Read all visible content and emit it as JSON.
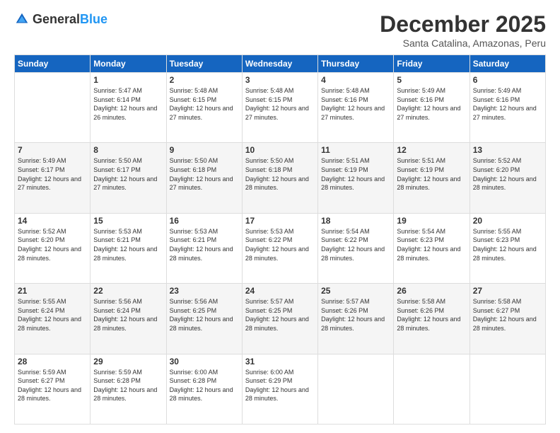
{
  "header": {
    "logo_general": "General",
    "logo_blue": "Blue",
    "month": "December 2025",
    "location": "Santa Catalina, Amazonas, Peru"
  },
  "days_of_week": [
    "Sunday",
    "Monday",
    "Tuesday",
    "Wednesday",
    "Thursday",
    "Friday",
    "Saturday"
  ],
  "weeks": [
    [
      {
        "day": "",
        "sunrise": "",
        "sunset": "",
        "daylight": "",
        "empty": true
      },
      {
        "day": "1",
        "sunrise": "Sunrise: 5:47 AM",
        "sunset": "Sunset: 6:14 PM",
        "daylight": "Daylight: 12 hours and 26 minutes."
      },
      {
        "day": "2",
        "sunrise": "Sunrise: 5:48 AM",
        "sunset": "Sunset: 6:15 PM",
        "daylight": "Daylight: 12 hours and 27 minutes."
      },
      {
        "day": "3",
        "sunrise": "Sunrise: 5:48 AM",
        "sunset": "Sunset: 6:15 PM",
        "daylight": "Daylight: 12 hours and 27 minutes."
      },
      {
        "day": "4",
        "sunrise": "Sunrise: 5:48 AM",
        "sunset": "Sunset: 6:16 PM",
        "daylight": "Daylight: 12 hours and 27 minutes."
      },
      {
        "day": "5",
        "sunrise": "Sunrise: 5:49 AM",
        "sunset": "Sunset: 6:16 PM",
        "daylight": "Daylight: 12 hours and 27 minutes."
      },
      {
        "day": "6",
        "sunrise": "Sunrise: 5:49 AM",
        "sunset": "Sunset: 6:16 PM",
        "daylight": "Daylight: 12 hours and 27 minutes."
      }
    ],
    [
      {
        "day": "7",
        "sunrise": "Sunrise: 5:49 AM",
        "sunset": "Sunset: 6:17 PM",
        "daylight": "Daylight: 12 hours and 27 minutes."
      },
      {
        "day": "8",
        "sunrise": "Sunrise: 5:50 AM",
        "sunset": "Sunset: 6:17 PM",
        "daylight": "Daylight: 12 hours and 27 minutes."
      },
      {
        "day": "9",
        "sunrise": "Sunrise: 5:50 AM",
        "sunset": "Sunset: 6:18 PM",
        "daylight": "Daylight: 12 hours and 27 minutes."
      },
      {
        "day": "10",
        "sunrise": "Sunrise: 5:50 AM",
        "sunset": "Sunset: 6:18 PM",
        "daylight": "Daylight: 12 hours and 28 minutes."
      },
      {
        "day": "11",
        "sunrise": "Sunrise: 5:51 AM",
        "sunset": "Sunset: 6:19 PM",
        "daylight": "Daylight: 12 hours and 28 minutes."
      },
      {
        "day": "12",
        "sunrise": "Sunrise: 5:51 AM",
        "sunset": "Sunset: 6:19 PM",
        "daylight": "Daylight: 12 hours and 28 minutes."
      },
      {
        "day": "13",
        "sunrise": "Sunrise: 5:52 AM",
        "sunset": "Sunset: 6:20 PM",
        "daylight": "Daylight: 12 hours and 28 minutes."
      }
    ],
    [
      {
        "day": "14",
        "sunrise": "Sunrise: 5:52 AM",
        "sunset": "Sunset: 6:20 PM",
        "daylight": "Daylight: 12 hours and 28 minutes."
      },
      {
        "day": "15",
        "sunrise": "Sunrise: 5:53 AM",
        "sunset": "Sunset: 6:21 PM",
        "daylight": "Daylight: 12 hours and 28 minutes."
      },
      {
        "day": "16",
        "sunrise": "Sunrise: 5:53 AM",
        "sunset": "Sunset: 6:21 PM",
        "daylight": "Daylight: 12 hours and 28 minutes."
      },
      {
        "day": "17",
        "sunrise": "Sunrise: 5:53 AM",
        "sunset": "Sunset: 6:22 PM",
        "daylight": "Daylight: 12 hours and 28 minutes."
      },
      {
        "day": "18",
        "sunrise": "Sunrise: 5:54 AM",
        "sunset": "Sunset: 6:22 PM",
        "daylight": "Daylight: 12 hours and 28 minutes."
      },
      {
        "day": "19",
        "sunrise": "Sunrise: 5:54 AM",
        "sunset": "Sunset: 6:23 PM",
        "daylight": "Daylight: 12 hours and 28 minutes."
      },
      {
        "day": "20",
        "sunrise": "Sunrise: 5:55 AM",
        "sunset": "Sunset: 6:23 PM",
        "daylight": "Daylight: 12 hours and 28 minutes."
      }
    ],
    [
      {
        "day": "21",
        "sunrise": "Sunrise: 5:55 AM",
        "sunset": "Sunset: 6:24 PM",
        "daylight": "Daylight: 12 hours and 28 minutes."
      },
      {
        "day": "22",
        "sunrise": "Sunrise: 5:56 AM",
        "sunset": "Sunset: 6:24 PM",
        "daylight": "Daylight: 12 hours and 28 minutes."
      },
      {
        "day": "23",
        "sunrise": "Sunrise: 5:56 AM",
        "sunset": "Sunset: 6:25 PM",
        "daylight": "Daylight: 12 hours and 28 minutes."
      },
      {
        "day": "24",
        "sunrise": "Sunrise: 5:57 AM",
        "sunset": "Sunset: 6:25 PM",
        "daylight": "Daylight: 12 hours and 28 minutes."
      },
      {
        "day": "25",
        "sunrise": "Sunrise: 5:57 AM",
        "sunset": "Sunset: 6:26 PM",
        "daylight": "Daylight: 12 hours and 28 minutes."
      },
      {
        "day": "26",
        "sunrise": "Sunrise: 5:58 AM",
        "sunset": "Sunset: 6:26 PM",
        "daylight": "Daylight: 12 hours and 28 minutes."
      },
      {
        "day": "27",
        "sunrise": "Sunrise: 5:58 AM",
        "sunset": "Sunset: 6:27 PM",
        "daylight": "Daylight: 12 hours and 28 minutes."
      }
    ],
    [
      {
        "day": "28",
        "sunrise": "Sunrise: 5:59 AM",
        "sunset": "Sunset: 6:27 PM",
        "daylight": "Daylight: 12 hours and 28 minutes."
      },
      {
        "day": "29",
        "sunrise": "Sunrise: 5:59 AM",
        "sunset": "Sunset: 6:28 PM",
        "daylight": "Daylight: 12 hours and 28 minutes."
      },
      {
        "day": "30",
        "sunrise": "Sunrise: 6:00 AM",
        "sunset": "Sunset: 6:28 PM",
        "daylight": "Daylight: 12 hours and 28 minutes."
      },
      {
        "day": "31",
        "sunrise": "Sunrise: 6:00 AM",
        "sunset": "Sunset: 6:29 PM",
        "daylight": "Daylight: 12 hours and 28 minutes."
      },
      {
        "day": "",
        "sunrise": "",
        "sunset": "",
        "daylight": "",
        "empty": true
      },
      {
        "day": "",
        "sunrise": "",
        "sunset": "",
        "daylight": "",
        "empty": true
      },
      {
        "day": "",
        "sunrise": "",
        "sunset": "",
        "daylight": "",
        "empty": true
      }
    ]
  ]
}
